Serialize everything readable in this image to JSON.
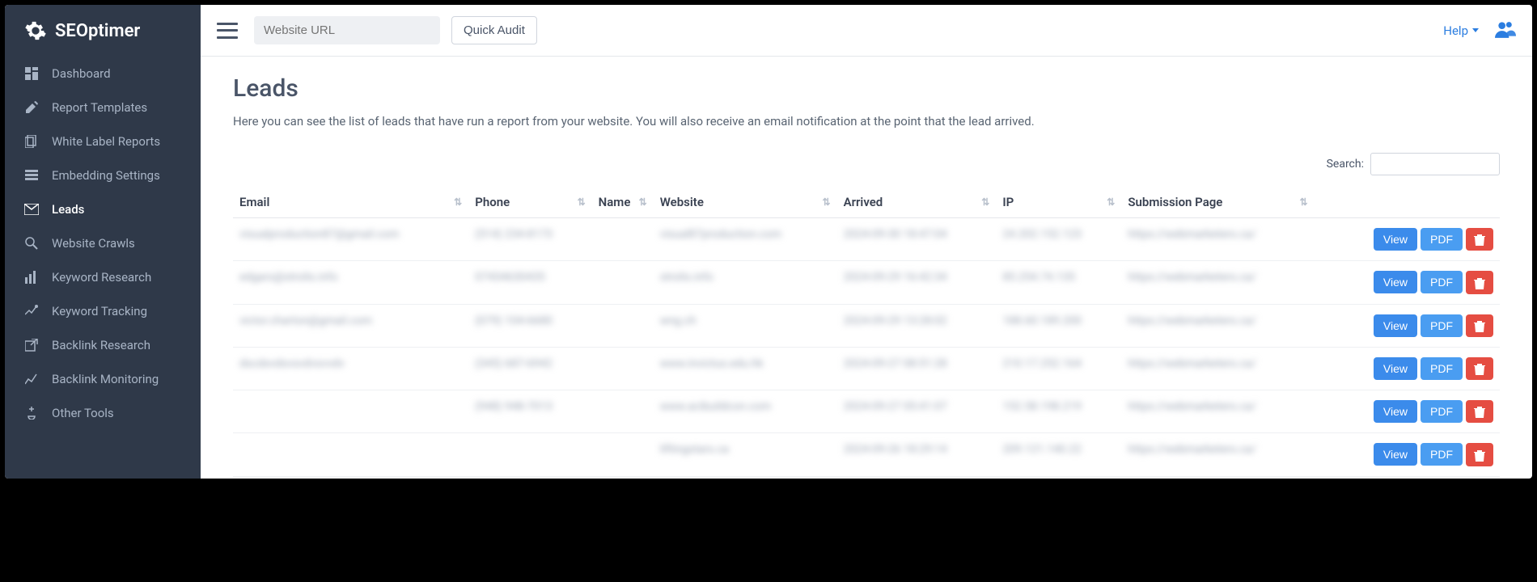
{
  "brand": "SEOptimer",
  "sidebar": {
    "items": [
      {
        "label": "Dashboard",
        "icon": "dashboard",
        "active": false
      },
      {
        "label": "Report Templates",
        "icon": "edit",
        "active": false
      },
      {
        "label": "White Label Reports",
        "icon": "copy",
        "active": false
      },
      {
        "label": "Embedding Settings",
        "icon": "sliders",
        "active": false
      },
      {
        "label": "Leads",
        "icon": "mail",
        "active": true
      },
      {
        "label": "Website Crawls",
        "icon": "search",
        "active": false
      },
      {
        "label": "Keyword Research",
        "icon": "bar-chart",
        "active": false
      },
      {
        "label": "Keyword Tracking",
        "icon": "trend",
        "active": false
      },
      {
        "label": "Backlink Research",
        "icon": "external",
        "active": false
      },
      {
        "label": "Backlink Monitoring",
        "icon": "line-chart",
        "active": false
      },
      {
        "label": "Other Tools",
        "icon": "tools",
        "active": false
      }
    ]
  },
  "header": {
    "url_placeholder": "Website URL",
    "quick_audit_label": "Quick Audit",
    "help_label": "Help"
  },
  "page": {
    "title": "Leads",
    "description": "Here you can see the list of leads that have run a report from your website. You will also receive an email notification at the point that the lead arrived.",
    "search_label": "Search:"
  },
  "table": {
    "columns": [
      "Email",
      "Phone",
      "Name",
      "Website",
      "Arrived",
      "IP",
      "Submission Page",
      ""
    ],
    "view_label": "View",
    "pdf_label": "PDF",
    "rows": [
      {
        "email": "visualproduction87@gmail.com",
        "phone": "(514) 234-8173",
        "name": "",
        "website": "visual87production.com",
        "arrived": "2024-09-30 18:47:04",
        "ip": "24.202.152.123",
        "submission": "https://webmarketers.ca/"
      },
      {
        "email": "edgars@strolis.info",
        "phone": "07434630435",
        "name": "",
        "website": "strolis.info",
        "arrived": "2024-09-29 16:42:34",
        "ip": "85.254.74.135",
        "submission": "https://webmarketers.ca/"
      },
      {
        "email": "victor.charton@gmail.com",
        "phone": "(079) 104-6680",
        "name": "",
        "website": "wng.ch",
        "arrived": "2024-09-29 13:28:02",
        "ip": "188.60.189.200",
        "submission": "https://webmarketers.ca/"
      },
      {
        "email": "dscdxvdsvsvdvsvvdv",
        "phone": "(345) 687-6942",
        "name": "",
        "website": "www.invictus.edu.hk",
        "arrived": "2024-09-27 08:51:28",
        "ip": "210.17.252.164",
        "submission": "https://webmarketers.ca/"
      },
      {
        "email": "",
        "phone": "(948) 948-7013",
        "name": "",
        "website": "www.acibuildcon.com",
        "arrived": "2024-09-27 05:41:07",
        "ip": "152.58.198.219",
        "submission": "https://webmarketers.ca/"
      },
      {
        "email": "",
        "phone": "",
        "name": "",
        "website": "liftingstars.ca",
        "arrived": "2024-09-26 18:29:14",
        "ip": "209.121.140.22",
        "submission": "https://webmarketers.ca/"
      }
    ]
  }
}
